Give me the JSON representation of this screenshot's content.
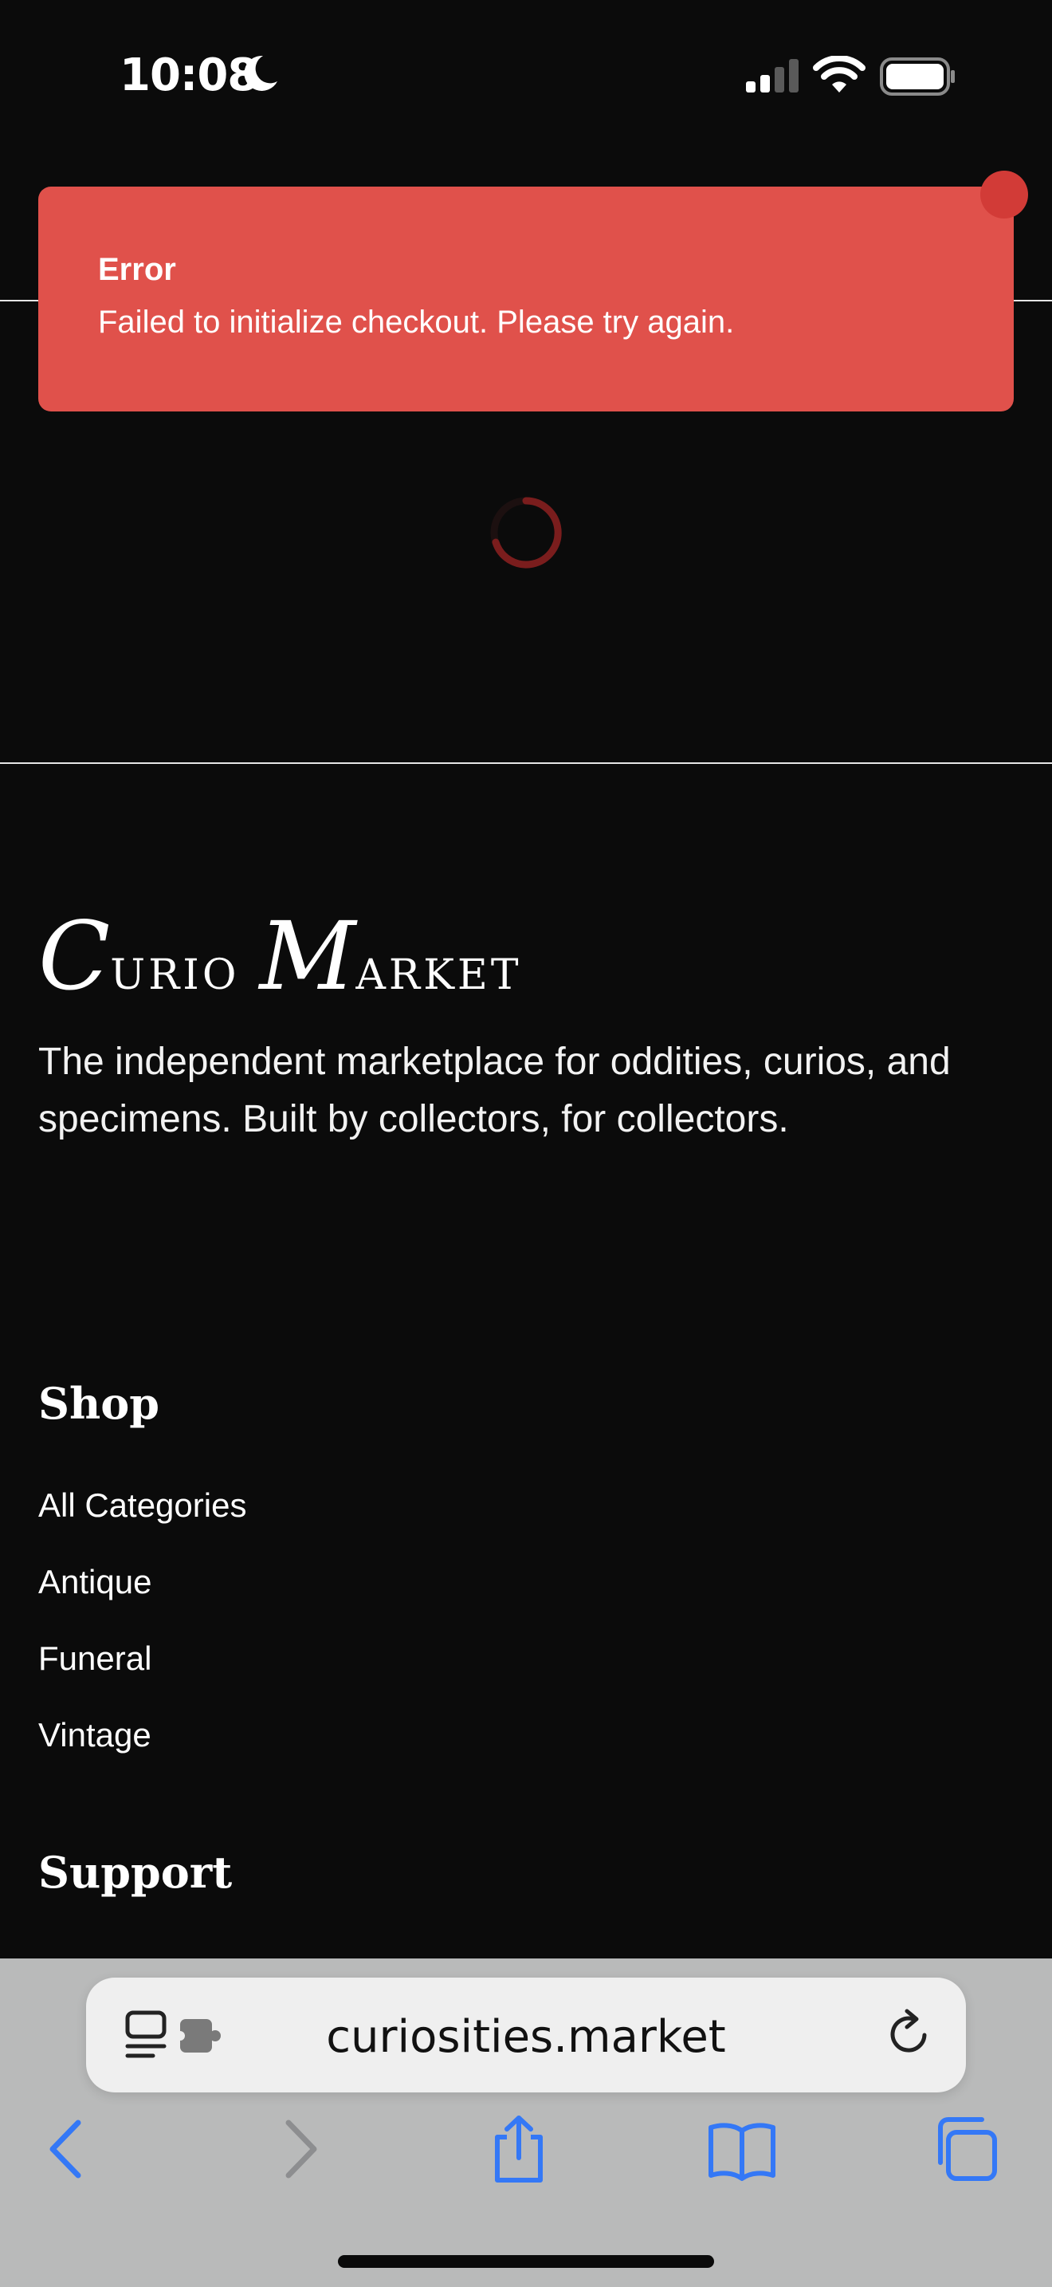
{
  "status_bar": {
    "time": "10:08",
    "icons": [
      "moon-icon",
      "cellular-signal-icon",
      "wifi-icon",
      "battery-icon"
    ]
  },
  "toast": {
    "title": "Error",
    "message": "Failed to initialize checkout. Please try again.",
    "background_color": "#e0514b"
  },
  "loading": {
    "spinner_color": "#7a1d1d"
  },
  "footer": {
    "brand": {
      "initial_1": "C",
      "rest_1": "URIO",
      "initial_2": "M",
      "rest_2": "ARKET"
    },
    "description": "The independent marketplace for oddities, curios, and specimens. Built by collectors, for collectors.",
    "shop": {
      "heading": "Shop",
      "links": [
        "All Categories",
        "Antique",
        "Funeral",
        "Vintage"
      ]
    },
    "support": {
      "heading": "Support"
    }
  },
  "browser": {
    "url": "curiosities.market",
    "accent_color": "#3478f6",
    "toolbar": [
      "back-icon",
      "forward-icon",
      "share-icon",
      "bookmarks-icon",
      "tabs-icon"
    ]
  }
}
